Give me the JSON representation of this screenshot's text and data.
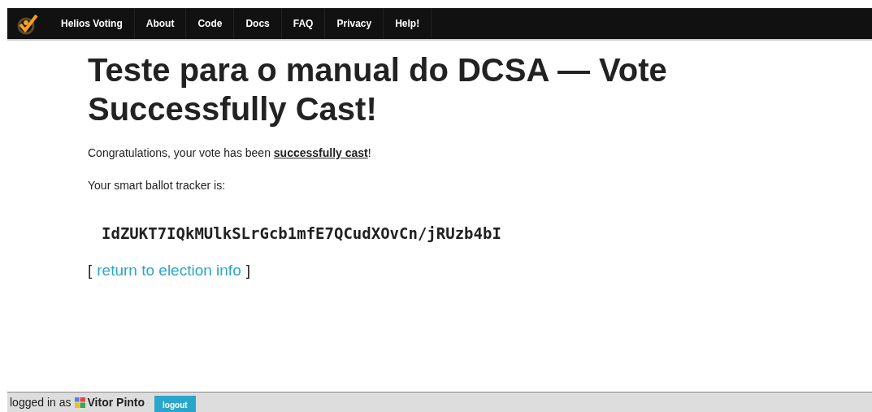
{
  "nav": {
    "items": [
      {
        "label": "Helios Voting",
        "selected": false
      },
      {
        "label": "About",
        "selected": false
      },
      {
        "label": "Code",
        "selected": false
      },
      {
        "label": "Docs",
        "selected": false
      },
      {
        "label": "FAQ",
        "selected": false
      },
      {
        "label": "Privacy",
        "selected": false
      },
      {
        "label": "Help!",
        "selected": false
      }
    ]
  },
  "heading": "Teste para o manual do DCSA — Vote Successfully Cast!",
  "message": "Congratulations, your vote has been **successfully cast**!",
  "tracker_label": "Your smart ballot tracker is:",
  "tracker": "IdZUKT7IQkMUlkSLrGcb1mfE7QCudXOvCn/jRUzb4bI",
  "return_link": {
    "open": "[",
    "label": "return to election info",
    "close": "]"
  },
  "footer": {
    "prefix": "logged in as",
    "user": "Vitor Pinto",
    "button": "logout"
  }
}
